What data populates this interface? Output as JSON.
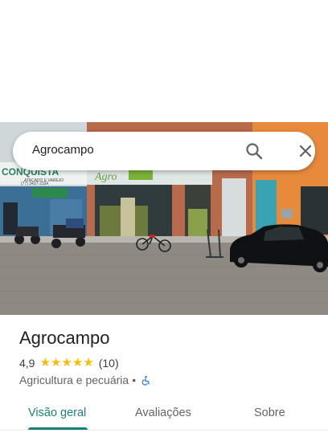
{
  "search": {
    "query": "Agrocampo"
  },
  "place": {
    "name": "Agrocampo",
    "rating": "4,9",
    "stars": 5,
    "review_count": "(10)",
    "category": "Agricultura e pecuária",
    "separator": "•",
    "accessible_icon": "wheelchair-icon"
  },
  "tabs": [
    {
      "label": "Visão geral",
      "active": true
    },
    {
      "label": "Avaliações",
      "active": false
    },
    {
      "label": "Sobre",
      "active": false
    }
  ],
  "photo": {
    "sign_left": "CONQUISTA",
    "sign_left_sub": "ATACADO E VAREJO",
    "sign_left_phone": "(77) 3427-2334",
    "sign_center": "Agro"
  },
  "colors": {
    "accent": "#1b7f79",
    "star": "#fbbc04",
    "accessible": "#1a73e8"
  }
}
